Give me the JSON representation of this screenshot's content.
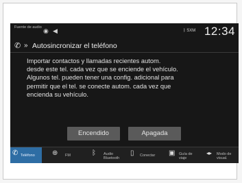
{
  "status_bar": {
    "source_label": "Fuente de audio",
    "signal_indicator": "SXM",
    "clock": "12:34"
  },
  "title_bar": {
    "title": "Autosincronizar el teléfono"
  },
  "body": {
    "lines": [
      "Importar contactos y llamadas recientes autom.",
      "desde este tel. cada vez que se enciende el vehículo.",
      "Algunos tel. pueden tener una config. adicional para",
      "permitir que el tel. se conecte autom. cada vez que",
      "encienda su vehículo."
    ]
  },
  "buttons": {
    "on_label": "Encendido",
    "off_label": "Apagada"
  },
  "nav": {
    "items": [
      {
        "label": "Teléfono",
        "icon": "phone-icon",
        "active": true
      },
      {
        "label": "FM",
        "icon": "radio-icon"
      },
      {
        "label": "Audio Bluetooth",
        "icon": "bluetooth-icon"
      },
      {
        "label": "Conectar",
        "icon": "phone-connect-icon"
      },
      {
        "label": "Guía de viaje",
        "icon": "guide-icon"
      },
      {
        "label": "Modo de visual.",
        "icon": "display-mode-icon"
      }
    ]
  }
}
